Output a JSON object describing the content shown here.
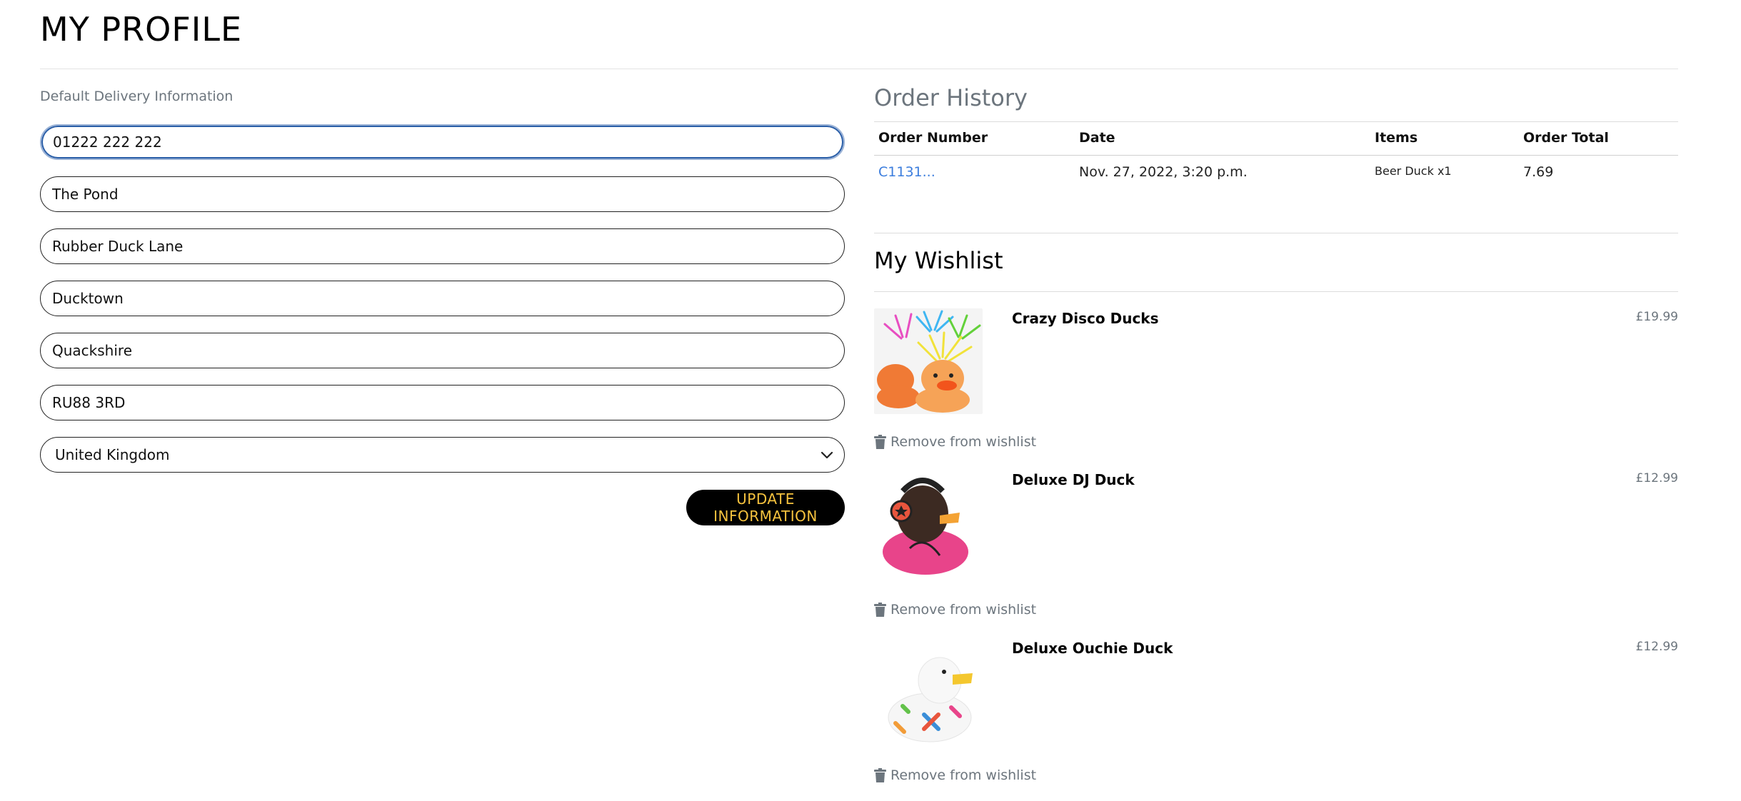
{
  "page": {
    "title": "MY PROFILE"
  },
  "delivery": {
    "section_label": "Default Delivery Information",
    "fields": [
      {
        "value": "01222 222 222"
      },
      {
        "value": "The Pond"
      },
      {
        "value": "Rubber Duck Lane"
      },
      {
        "value": "Ducktown"
      },
      {
        "value": "Quackshire"
      },
      {
        "value": "RU88 3RD"
      }
    ],
    "country": "United Kingdom",
    "update_label": "UPDATE INFORMATION"
  },
  "orders": {
    "title": "Order History",
    "columns": [
      "Order Number",
      "Date",
      "Items",
      "Order Total"
    ],
    "rows": [
      {
        "number": "C1131...",
        "date": "Nov. 27, 2022, 3:20 p.m.",
        "items": "Beer Duck x1",
        "total": "7.69"
      }
    ]
  },
  "wishlist": {
    "title": "My Wishlist",
    "remove_label": "Remove from wishlist",
    "items": [
      {
        "name": "Crazy Disco Ducks",
        "price": "£19.99"
      },
      {
        "name": "Deluxe DJ Duck",
        "price": "£12.99"
      },
      {
        "name": "Deluxe Ouchie Duck",
        "price": "£12.99"
      }
    ]
  },
  "colors": {
    "button_bg": "#000000",
    "button_text": "#f6c23e",
    "link": "#3b7ddd",
    "muted": "#6c757d"
  }
}
